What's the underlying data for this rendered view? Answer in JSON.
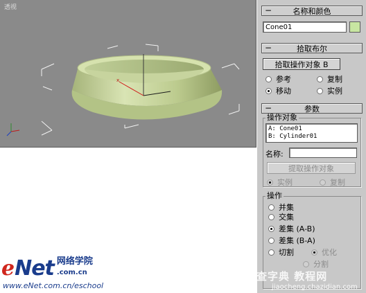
{
  "viewport": {
    "label": "透视",
    "object_color": "#c8d9a0",
    "background_color": "#8a8a8a"
  },
  "name_color": {
    "header": "名称和颜色",
    "object_name": "Cone01",
    "swatch_color": "#c8e6a2"
  },
  "pick_boolean": {
    "header": "拾取布尔",
    "pick_button": "拾取操作对象 B",
    "options": [
      "参考",
      "复制",
      "移动",
      "实例"
    ],
    "selected": "移动"
  },
  "parameters": {
    "header": "参数",
    "operands_group": "操作对象",
    "operands": [
      "A: Cone01",
      "B: Cylinder01"
    ],
    "name_label": "名称:",
    "name_value": "",
    "extract_button": "提取操作对象",
    "extract_options": [
      "实例",
      "复制"
    ],
    "operation_group": "操作",
    "operations": [
      "并集",
      "交集",
      "差集 (A-B)",
      "差集 (B-A)",
      "切割"
    ],
    "selected_operation": "差集 (A-B)",
    "cut_options": [
      "优化",
      "分割"
    ]
  },
  "branding": {
    "logo_e": "e",
    "logo_net": "Net",
    "logo_cn": "网络学院",
    "logo_cn_domain": ".com.cn",
    "url": "www.eNet.com.cn/eschool",
    "watermark": "查字典 教程网",
    "watermark_url": "jiaocheng.chazidian.com"
  }
}
